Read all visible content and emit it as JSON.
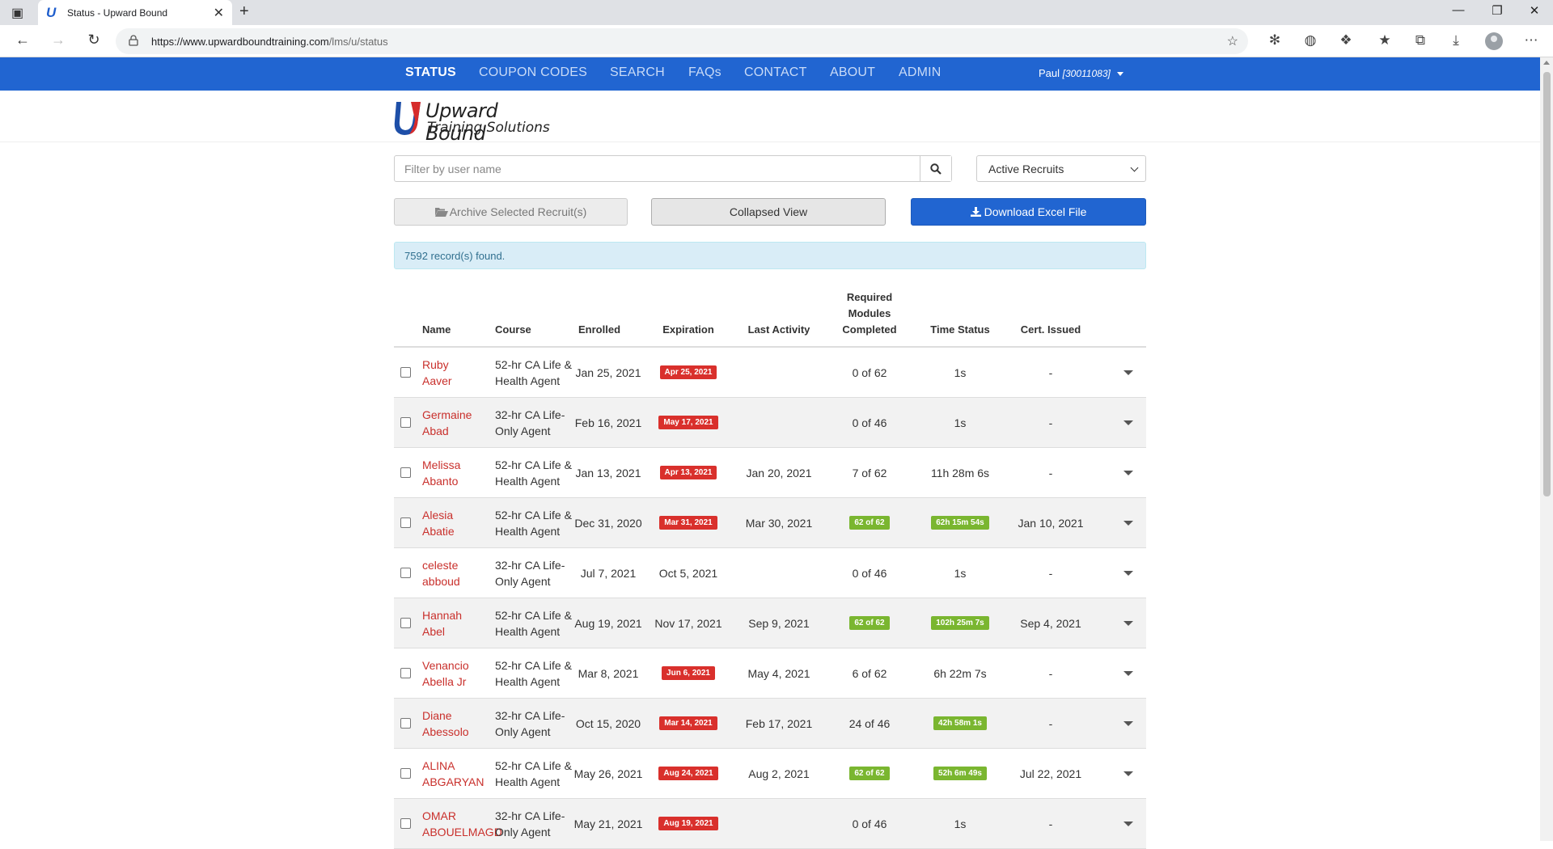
{
  "browser": {
    "tab_title": "Status - Upward Bound",
    "url_host": "https://www.upwardboundtraining.com",
    "url_path": "/lms/u/status"
  },
  "nav": {
    "items": [
      "STATUS",
      "COUPON CODES",
      "SEARCH",
      "FAQs",
      "CONTACT",
      "ABOUT",
      "ADMIN"
    ],
    "active": "STATUS",
    "user_name": "Paul",
    "user_id": "[30011083]"
  },
  "logo": {
    "line1": "Upward Bound",
    "line2": "Training Solutions"
  },
  "controls": {
    "search_placeholder": "Filter by user name",
    "filter_selected": "Active Recruits",
    "archive_label": "Archive Selected Recruit(s)",
    "collapse_label": "Collapsed View",
    "download_label": "Download Excel File"
  },
  "records_text": "7592 record(s) found.",
  "table": {
    "headers": {
      "name": "Name",
      "course": "Course",
      "enrolled": "Enrolled",
      "expiration": "Expiration",
      "last_activity": "Last Activity",
      "required_line1": "Required",
      "required_line2": "Modules",
      "required_line3": "Completed",
      "time_status": "Time Status",
      "cert": "Cert. Issued"
    },
    "rows": [
      {
        "first": "Ruby",
        "last": "Aaver",
        "course1": "52-hr CA Life &",
        "course2": "Health Agent",
        "enrolled": "Jan 25, 2021",
        "expiration": "Apr 25, 2021",
        "exp_style": "red",
        "last_activity": "",
        "modules": "0 of 62",
        "mod_style": "plain",
        "time": "1s",
        "time_style": "plain",
        "cert": "-"
      },
      {
        "first": "Germaine",
        "last": "Abad",
        "course1": "32-hr CA Life-",
        "course2": "Only Agent",
        "enrolled": "Feb 16, 2021",
        "expiration": "May 17, 2021",
        "exp_style": "red",
        "last_activity": "",
        "modules": "0 of 46",
        "mod_style": "plain",
        "time": "1s",
        "time_style": "plain",
        "cert": "-"
      },
      {
        "first": "Melissa",
        "last": "Abanto",
        "course1": "52-hr CA Life &",
        "course2": "Health Agent",
        "enrolled": "Jan 13, 2021",
        "expiration": "Apr 13, 2021",
        "exp_style": "red",
        "last_activity": "Jan 20, 2021",
        "modules": "7 of 62",
        "mod_style": "plain",
        "time": "11h 28m 6s",
        "time_style": "plain",
        "cert": "-"
      },
      {
        "first": "Alesia",
        "last": "Abatie",
        "course1": "52-hr CA Life &",
        "course2": "Health Agent",
        "enrolled": "Dec 31, 2020",
        "expiration": "Mar 31, 2021",
        "exp_style": "red",
        "last_activity": "Mar 30, 2021",
        "modules": "62 of 62",
        "mod_style": "green",
        "time": "62h 15m 54s",
        "time_style": "green",
        "cert": "Jan 10, 2021"
      },
      {
        "first": "celeste",
        "last": "abboud",
        "course1": "32-hr CA Life-",
        "course2": "Only Agent",
        "enrolled": "Jul 7, 2021",
        "expiration": "Oct 5, 2021",
        "exp_style": "plain",
        "last_activity": "",
        "modules": "0 of 46",
        "mod_style": "plain",
        "time": "1s",
        "time_style": "plain",
        "cert": "-"
      },
      {
        "first": "Hannah",
        "last": "Abel",
        "course1": "52-hr CA Life &",
        "course2": "Health Agent",
        "enrolled": "Aug 19, 2021",
        "expiration": "Nov 17, 2021",
        "exp_style": "plain",
        "last_activity": "Sep 9, 2021",
        "modules": "62 of 62",
        "mod_style": "green",
        "time": "102h 25m 7s",
        "time_style": "green",
        "cert": "Sep 4, 2021"
      },
      {
        "first": "Venancio",
        "last": "Abella Jr",
        "course1": "52-hr CA Life &",
        "course2": "Health Agent",
        "enrolled": "Mar 8, 2021",
        "expiration": "Jun 6, 2021",
        "exp_style": "red",
        "last_activity": "May 4, 2021",
        "modules": "6 of 62",
        "mod_style": "plain",
        "time": "6h 22m 7s",
        "time_style": "plain",
        "cert": "-"
      },
      {
        "first": "Diane",
        "last": "Abessolo",
        "course1": "32-hr CA Life-",
        "course2": "Only Agent",
        "enrolled": "Oct 15, 2020",
        "expiration": "Mar 14, 2021",
        "exp_style": "red",
        "last_activity": "Feb 17, 2021",
        "modules": "24 of 46",
        "mod_style": "plain",
        "time": "42h 58m 1s",
        "time_style": "green",
        "cert": "-"
      },
      {
        "first": "ALINA",
        "last": "ABGARYAN",
        "course1": "52-hr CA Life &",
        "course2": "Health Agent",
        "enrolled": "May 26, 2021",
        "expiration": "Aug 24, 2021",
        "exp_style": "red",
        "last_activity": "Aug 2, 2021",
        "modules": "62 of 62",
        "mod_style": "green",
        "time": "52h 6m 49s",
        "time_style": "green",
        "cert": "Jul 22, 2021"
      },
      {
        "first": "OMAR",
        "last": "ABOUELMAGD",
        "course1": "32-hr CA Life-",
        "course2": "Only Agent",
        "enrolled": "May 21, 2021",
        "expiration": "Aug 19, 2021",
        "exp_style": "red",
        "last_activity": "",
        "modules": "0 of 46",
        "mod_style": "plain",
        "time": "1s",
        "time_style": "plain",
        "cert": "-"
      }
    ]
  },
  "colors": {
    "nav_blue": "#2165d1",
    "danger": "#d9302c",
    "success": "#7ab630",
    "link_red": "#c9302c"
  }
}
